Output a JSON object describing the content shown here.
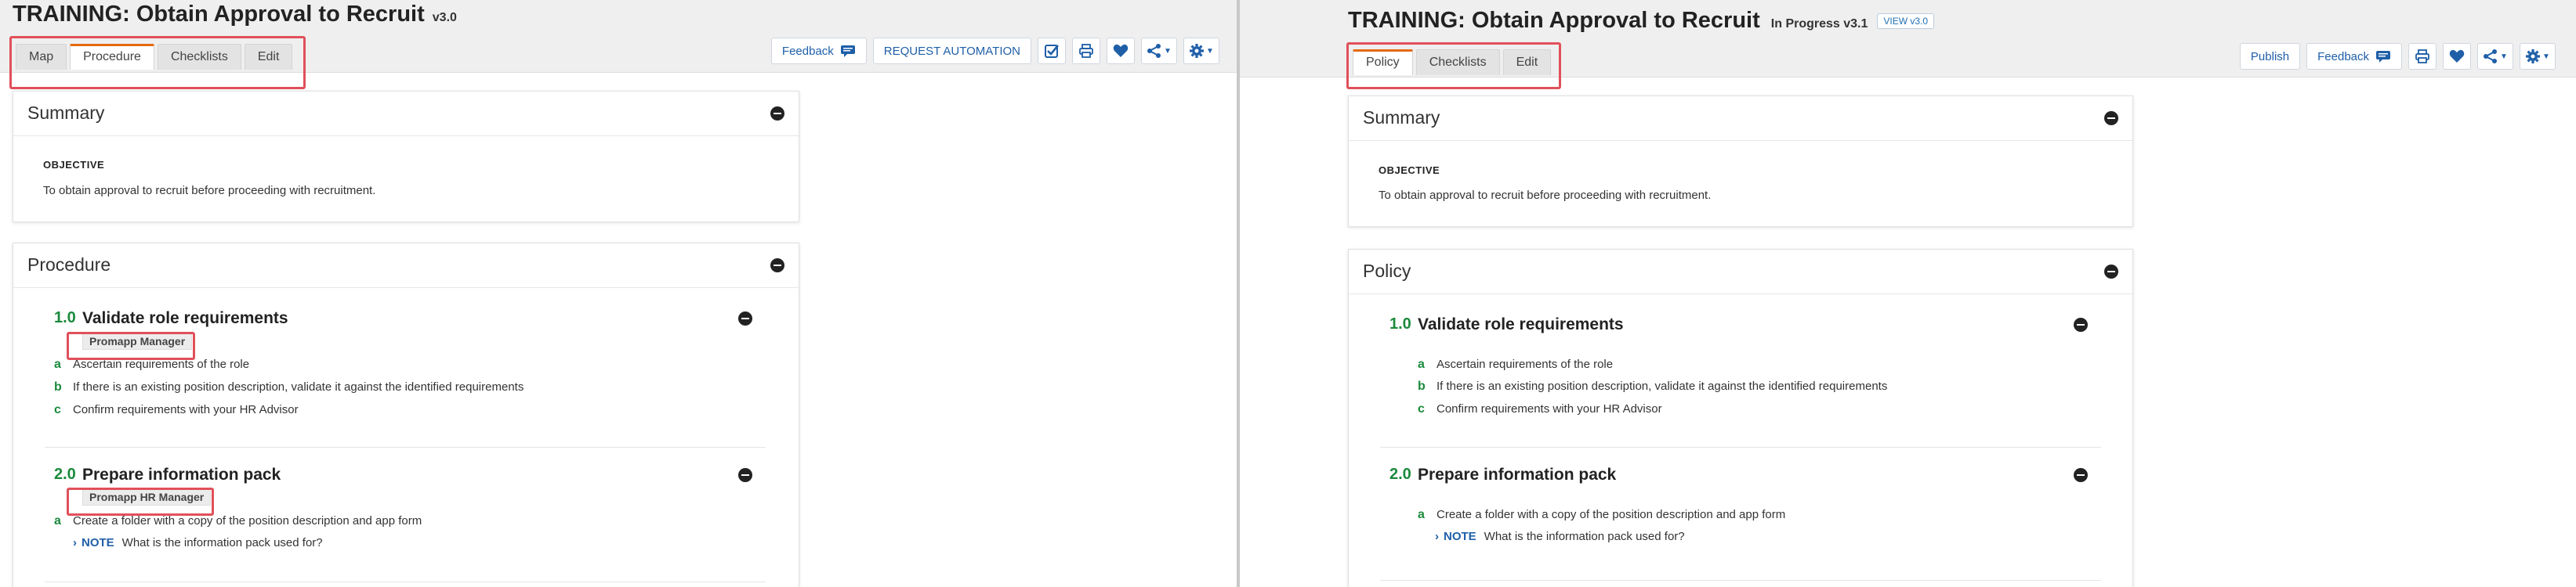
{
  "left": {
    "title": "TRAINING: Obtain Approval to Recruit",
    "version": "v3.0",
    "tabs": [
      "Map",
      "Procedure",
      "Checklists",
      "Edit"
    ],
    "toolbar": {
      "feedback": "Feedback",
      "request_automation": "REQUEST AUTOMATION"
    },
    "summary": {
      "heading": "Summary",
      "objective_label": "OBJECTIVE",
      "objective_text": "To obtain approval to recruit before proceeding with recruitment."
    },
    "procedure": {
      "heading": "Procedure",
      "steps": [
        {
          "num": "1.0",
          "title": "Validate role requirements",
          "role": "Promapp Manager",
          "tasks": [
            {
              "letter": "a",
              "text": "Ascertain requirements of the role"
            },
            {
              "letter": "b",
              "text": "If there is an existing position description, validate it against the identified requirements"
            },
            {
              "letter": "c",
              "text": "Confirm requirements with your HR Advisor"
            }
          ]
        },
        {
          "num": "2.0",
          "title": "Prepare information pack",
          "role": "Promapp HR Manager",
          "tasks": [
            {
              "letter": "a",
              "text": "Create a folder with a copy of the position description and app form"
            }
          ],
          "note": {
            "label": "NOTE",
            "text": "What is the information pack used for?"
          }
        }
      ]
    }
  },
  "right": {
    "title": "TRAINING: Obtain Approval to Recruit",
    "status": "In Progress v3.1",
    "view_button": "VIEW v3.0",
    "tabs": [
      "Policy",
      "Checklists",
      "Edit"
    ],
    "toolbar": {
      "publish": "Publish",
      "feedback": "Feedback"
    },
    "summary": {
      "heading": "Summary",
      "objective_label": "OBJECTIVE",
      "objective_text": "To obtain approval to recruit before proceeding with recruitment."
    },
    "policy": {
      "heading": "Policy",
      "steps": [
        {
          "num": "1.0",
          "title": "Validate role requirements",
          "tasks": [
            {
              "letter": "a",
              "text": "Ascertain requirements of the role"
            },
            {
              "letter": "b",
              "text": "If there is an existing position description, validate it against the identified requirements"
            },
            {
              "letter": "c",
              "text": "Confirm requirements with your HR Advisor"
            }
          ]
        },
        {
          "num": "2.0",
          "title": "Prepare information pack",
          "tasks": [
            {
              "letter": "a",
              "text": "Create a folder with a copy of the position description and app form"
            }
          ],
          "note": {
            "label": "NOTE",
            "text": "What is the information pack used for?"
          }
        }
      ]
    }
  },
  "colors": {
    "accent_tab": "#e56a10",
    "highlight_box": "#e0505a",
    "step_number": "#1b8a3c",
    "link_blue": "#1f5fa8",
    "arrow": "#1e3f66"
  },
  "icons": [
    "feedback-icon",
    "checkbox-icon",
    "print-icon",
    "heart-icon",
    "share-icon",
    "gear-icon",
    "collapse-icon",
    "chevron-right-icon",
    "arrow-right-icon"
  ]
}
